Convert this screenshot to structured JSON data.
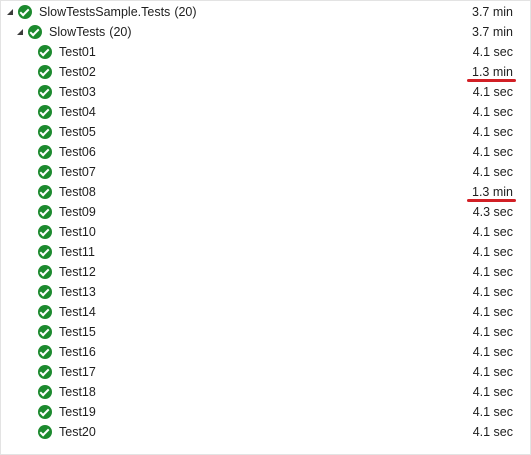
{
  "tree": {
    "assembly": {
      "name": "SlowTestsSample.Tests",
      "count": "(20)",
      "duration": "3.7 min",
      "status_icon": "passed-check-icon",
      "expanded": true
    },
    "class": {
      "name": "SlowTests",
      "count": "(20)",
      "duration": "3.7 min",
      "status_icon": "passed-check-icon",
      "expanded": true
    },
    "tests": [
      {
        "name": "Test01",
        "duration": "4.1 sec"
      },
      {
        "name": "Test02",
        "duration": "1.3 min",
        "highlighted": true
      },
      {
        "name": "Test03",
        "duration": "4.1 sec"
      },
      {
        "name": "Test04",
        "duration": "4.1 sec"
      },
      {
        "name": "Test05",
        "duration": "4.1 sec"
      },
      {
        "name": "Test06",
        "duration": "4.1 sec"
      },
      {
        "name": "Test07",
        "duration": "4.1 sec"
      },
      {
        "name": "Test08",
        "duration": "1.3 min",
        "highlighted": true
      },
      {
        "name": "Test09",
        "duration": "4.3 sec"
      },
      {
        "name": "Test10",
        "duration": "4.1 sec"
      },
      {
        "name": "Test11",
        "duration": "4.1 sec"
      },
      {
        "name": "Test12",
        "duration": "4.1 sec"
      },
      {
        "name": "Test13",
        "duration": "4.1 sec"
      },
      {
        "name": "Test14",
        "duration": "4.1 sec"
      },
      {
        "name": "Test15",
        "duration": "4.1 sec"
      },
      {
        "name": "Test16",
        "duration": "4.1 sec"
      },
      {
        "name": "Test17",
        "duration": "4.1 sec"
      },
      {
        "name": "Test18",
        "duration": "4.1 sec"
      },
      {
        "name": "Test19",
        "duration": "4.1 sec"
      },
      {
        "name": "Test20",
        "duration": "4.1 sec"
      }
    ]
  },
  "colors": {
    "passed": "#1c8a2e",
    "highlight_underline": "#d21f25",
    "text": "#1e1e1e"
  }
}
